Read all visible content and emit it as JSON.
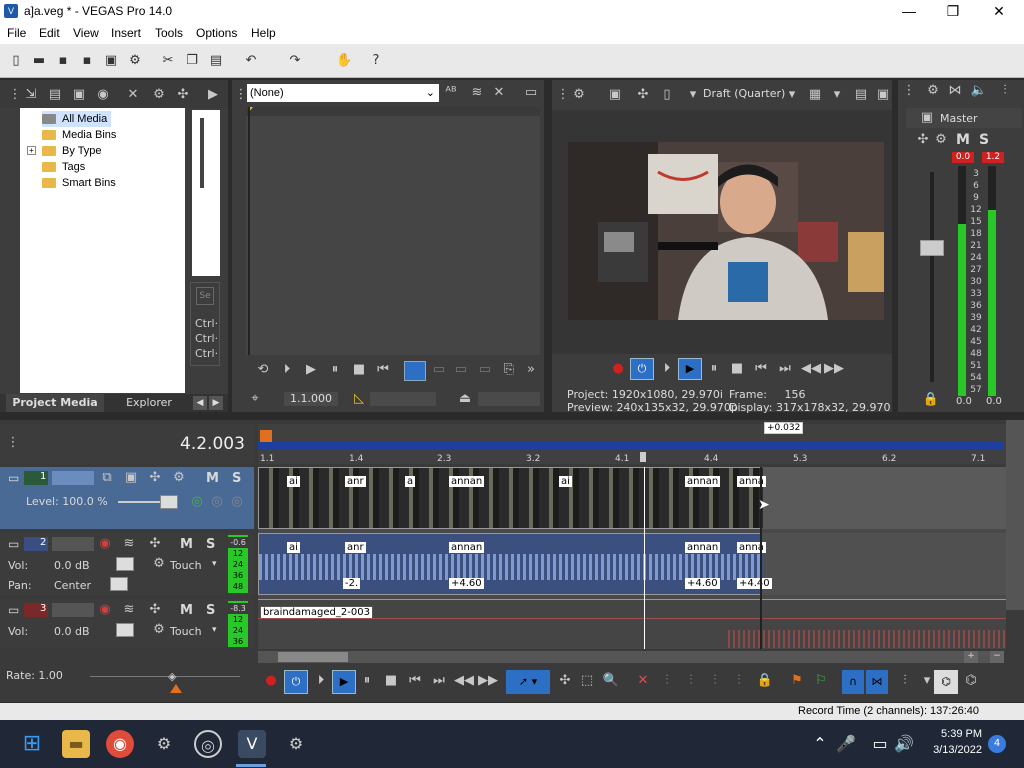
{
  "window": {
    "title": "a]a.veg * - VEGAS Pro 14.0",
    "app_icon": "vegas-icon"
  },
  "menu": [
    "File",
    "Edit",
    "View",
    "Insert",
    "Tools",
    "Options",
    "Help"
  ],
  "project_media": {
    "tree": [
      "All Media",
      "Media Bins",
      "By Type",
      "Tags",
      "Smart Bins"
    ],
    "tabs": [
      "Project Media",
      "Explorer"
    ],
    "side_labels": [
      "Ctrl·",
      "Ctrl·",
      "Ctrl·"
    ]
  },
  "trimmer": {
    "dropdown": "(None)",
    "time": "1.1.000"
  },
  "preview": {
    "quality": "Draft (Quarter)",
    "project_label": "Project:",
    "project_value": "1920x1080, 29.970i",
    "preview_label": "Preview:",
    "preview_value": "240x135x32, 29.970p",
    "frame_label": "Frame:",
    "frame_value": "156",
    "display_label": "Display:",
    "display_value": "317x178x32, 29.970"
  },
  "master": {
    "title": "Master",
    "m": "M",
    "s": "S",
    "peak_l": "0.0",
    "peak_r": "1.2",
    "scale": [
      "3",
      "6",
      "9",
      "12",
      "15",
      "18",
      "21",
      "24",
      "27",
      "30",
      "33",
      "36",
      "39",
      "42",
      "45",
      "48",
      "51",
      "54",
      "57"
    ],
    "bottom_l": "0.0",
    "bottom_r": "0.0"
  },
  "timeline": {
    "cursor_time": "4.2.003",
    "marker_offset": "+0.032",
    "ruler": [
      "1.1",
      "1.4",
      "2.3",
      "3.2",
      "4.1",
      "4.4",
      "5.3",
      "6.2",
      "7.1"
    ],
    "tracks": [
      {
        "num": "1",
        "type": "video",
        "level_label": "Level: 100.0 %",
        "m": "M",
        "s": "S"
      },
      {
        "num": "2",
        "type": "audio",
        "vol_label": "Vol:",
        "vol": "0.0 dB",
        "pan_label": "Pan:",
        "pan": "Center",
        "mode": "Touch",
        "m": "M",
        "s": "S",
        "meter": [
          "-0.6",
          "12",
          "24",
          "36",
          "48"
        ]
      },
      {
        "num": "3",
        "type": "audio",
        "vol_label": "Vol:",
        "vol": "0.0 dB",
        "mode": "Touch",
        "m": "M",
        "s": "S",
        "meter": [
          "-8.3",
          "12",
          "24",
          "36"
        ]
      }
    ],
    "clip_labels": [
      "ai",
      "anr",
      "a",
      "annan",
      "anna",
      "+4.60",
      "-2.",
      "+4.40",
      "braindamaged_2-003"
    ]
  },
  "transport": {
    "rate": "Rate: 1.00"
  },
  "status": {
    "record_time": "Record Time (2 channels): 137:26:40"
  },
  "taskbar": {
    "time": "5:39 PM",
    "date": "3/13/2022",
    "badge": "4"
  },
  "colors": {
    "accent_blue": "#1c3fa0",
    "meter_green": "#28c828",
    "peak_red": "#d02020"
  }
}
